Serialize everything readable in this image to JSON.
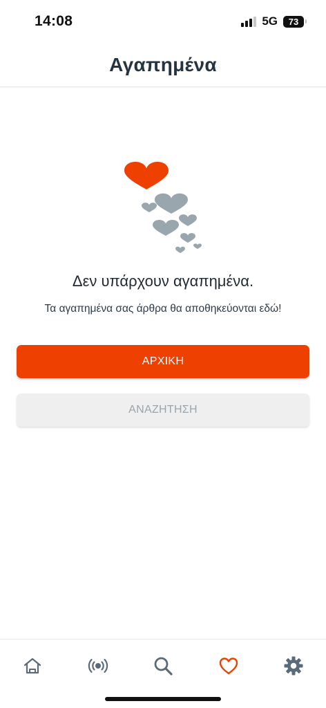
{
  "status_bar": {
    "time": "14:08",
    "network": "5G",
    "battery": "73"
  },
  "header": {
    "title": "Αγαπημένα"
  },
  "empty_state": {
    "illustration_icon": "hearts-icon",
    "title": "Δεν υπάρχουν αγαπημένα.",
    "subtitle": "Τα αγαπημένα σας άρθρα θα αποθηκεύονται εδώ!"
  },
  "buttons": {
    "home_label": "ΑΡΧΙΚΗ",
    "search_label": "ΑΝΑΖΗΤΗΣΗ"
  },
  "bottom_nav": {
    "items": [
      {
        "icon": "home-icon",
        "active": false
      },
      {
        "icon": "live-radio-icon",
        "active": false
      },
      {
        "icon": "search-icon",
        "active": false
      },
      {
        "icon": "heart-icon",
        "active": true
      },
      {
        "icon": "gear-icon",
        "active": false
      }
    ]
  },
  "colors": {
    "accent": "#ee4000",
    "icon_inactive": "#5a6a78",
    "heart_gray": "#9aa6ae",
    "disabled_button_bg": "#efefef",
    "disabled_button_text": "#9aa4ac"
  }
}
